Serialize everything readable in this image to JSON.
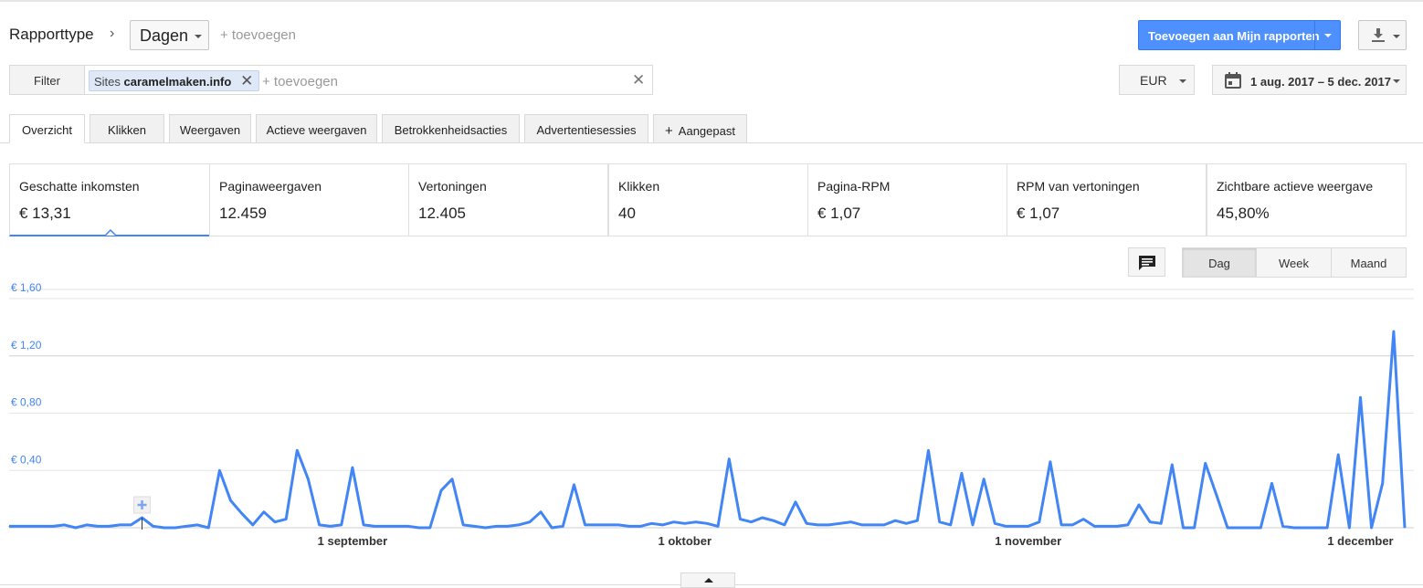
{
  "header": {
    "report_type_label": "Rapporttype",
    "chevron": "›",
    "dimension_selected": "Dagen",
    "add_dimension": "+ toevoegen",
    "add_to_reports_button": "Toevoegen aan Mijn rapporten"
  },
  "filter": {
    "filter_button": "Filter",
    "chip_prefix": "Sites",
    "chip_value": "caramelmaken.info",
    "chip_remove": "✕",
    "add_placeholder": "+ toevoegen",
    "clear": "✕"
  },
  "currency": {
    "selected": "EUR"
  },
  "date_range": {
    "label": "1 aug. 2017 – 5 dec. 2017"
  },
  "tabs": [
    {
      "label": "Overzicht",
      "active": true
    },
    {
      "label": "Klikken",
      "active": false
    },
    {
      "label": "Weergaven",
      "active": false
    },
    {
      "label": "Actieve weergaven",
      "active": false
    },
    {
      "label": "Betrokkenheidsacties",
      "active": false
    },
    {
      "label": "Advertentiesessies",
      "active": false
    },
    {
      "label": "Aangepast",
      "active": false
    }
  ],
  "custom_tab_plus": "+",
  "metrics": [
    {
      "name": "Geschatte inkomsten",
      "value": "€ 13,31",
      "active": true
    },
    {
      "name": "Paginaweergaven",
      "value": "12.459",
      "active": false
    },
    {
      "name": "Vertoningen",
      "value": "12.405",
      "active": false
    },
    {
      "name": "Klikken",
      "value": "40",
      "active": false
    },
    {
      "name": "Pagina-RPM",
      "value": "€ 1,07",
      "active": false
    },
    {
      "name": "RPM van vertoningen",
      "value": "€ 1,07",
      "active": false
    },
    {
      "name": "Zichtbare actieve weergave",
      "value": "45,80%",
      "active": false
    }
  ],
  "granularity": [
    {
      "label": "Dag",
      "active": true
    },
    {
      "label": "Week",
      "active": false
    },
    {
      "label": "Maand",
      "active": false
    }
  ],
  "icons": {
    "download": "download-icon",
    "calendar": "calendar-icon",
    "comment": "comment-icon",
    "annotation": "plus-icon"
  },
  "colors": {
    "accent": "#4285f4",
    "primary_button": "#4d90fe",
    "chip_bg": "#dfe8f6"
  },
  "chart_data": {
    "type": "line",
    "start_date": "2017-08-01",
    "end_date": "2017-12-05",
    "ylim": [
      0,
      1.6
    ],
    "yticks": [
      {
        "value": 0.4,
        "label": "€ 0,40"
      },
      {
        "value": 0.8,
        "label": "€ 0,80"
      },
      {
        "value": 1.2,
        "label": "€ 1,20"
      },
      {
        "value": 1.6,
        "label": "€ 1,60"
      }
    ],
    "xticks": [
      {
        "date": "2017-09-01",
        "label": "1 september"
      },
      {
        "date": "2017-10-01",
        "label": "1 oktober"
      },
      {
        "date": "2017-11-01",
        "label": "1 november"
      },
      {
        "date": "2017-12-01",
        "label": "1 december"
      }
    ],
    "grid": true,
    "series": [
      {
        "color": "#4285f4",
        "values": [
          0.01,
          0.01,
          0.01,
          0.01,
          0.01,
          0.02,
          0.0,
          0.02,
          0.01,
          0.01,
          0.02,
          0.02,
          0.07,
          0.01,
          0.0,
          0.0,
          0.01,
          0.02,
          0.0,
          0.4,
          0.19,
          0.1,
          0.02,
          0.11,
          0.04,
          0.06,
          0.54,
          0.34,
          0.02,
          0.01,
          0.02,
          0.42,
          0.02,
          0.01,
          0.01,
          0.01,
          0.01,
          0.0,
          0.0,
          0.26,
          0.34,
          0.02,
          0.01,
          0.0,
          0.01,
          0.01,
          0.02,
          0.04,
          0.11,
          0.0,
          0.01,
          0.3,
          0.02,
          0.02,
          0.02,
          0.02,
          0.01,
          0.01,
          0.03,
          0.02,
          0.04,
          0.03,
          0.04,
          0.03,
          0.01,
          0.48,
          0.06,
          0.04,
          0.07,
          0.05,
          0.02,
          0.18,
          0.03,
          0.02,
          0.02,
          0.03,
          0.04,
          0.02,
          0.02,
          0.02,
          0.05,
          0.03,
          0.05,
          0.54,
          0.04,
          0.02,
          0.38,
          0.02,
          0.34,
          0.03,
          0.01,
          0.01,
          0.01,
          0.04,
          0.46,
          0.02,
          0.02,
          0.06,
          0.01,
          0.01,
          0.01,
          0.02,
          0.16,
          0.04,
          0.03,
          0.44,
          0.0,
          0.0,
          0.45,
          0.23,
          0.0,
          0.0,
          0.0,
          0.0,
          0.31,
          0.01,
          0.0,
          0.0,
          0.0,
          0.0,
          0.51,
          0.0,
          0.91,
          0.0,
          0.31,
          1.37,
          0.0
        ]
      }
    ]
  }
}
